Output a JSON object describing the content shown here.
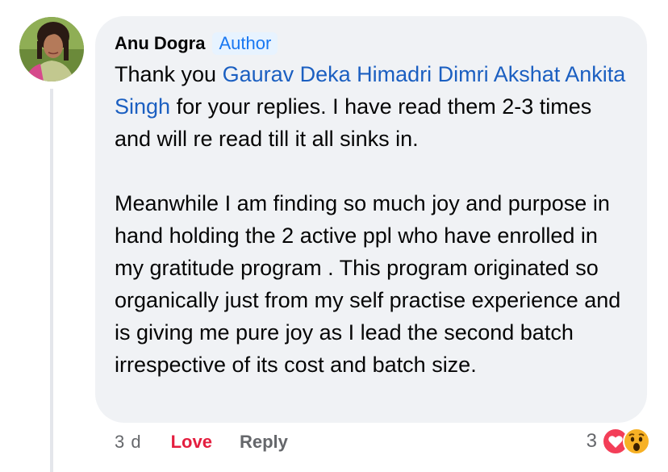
{
  "comment": {
    "author": "Anu Dogra",
    "badge": "Author",
    "text_before_mentions": "Thank you ",
    "mentions": [
      "Gaurav Deka",
      "Himadri Dimri",
      "Akshat",
      "Ankita Singh"
    ],
    "text_after_mentions": " for your replies. I have read them 2-3 times and will re read till it all sinks in.",
    "paragraph_2": "Meanwhile I am finding so much joy and purpose in hand holding the 2 active ppl who have enrolled in my gratitude program . This program originated so organically just from my self practise experience and is giving me pure joy as I lead the second batch irrespective of its cost and batch size."
  },
  "actions": {
    "time": "3 d",
    "love": "Love",
    "reply": "Reply"
  },
  "reactions": {
    "count": "3",
    "types": [
      "love-icon",
      "wow-icon"
    ]
  },
  "colors": {
    "bubble": "#f0f2f5",
    "mention": "#1b5fc1",
    "love": "#e41e3f",
    "badge_text": "#1877f2",
    "badge_bg": "#e7f3ff"
  }
}
